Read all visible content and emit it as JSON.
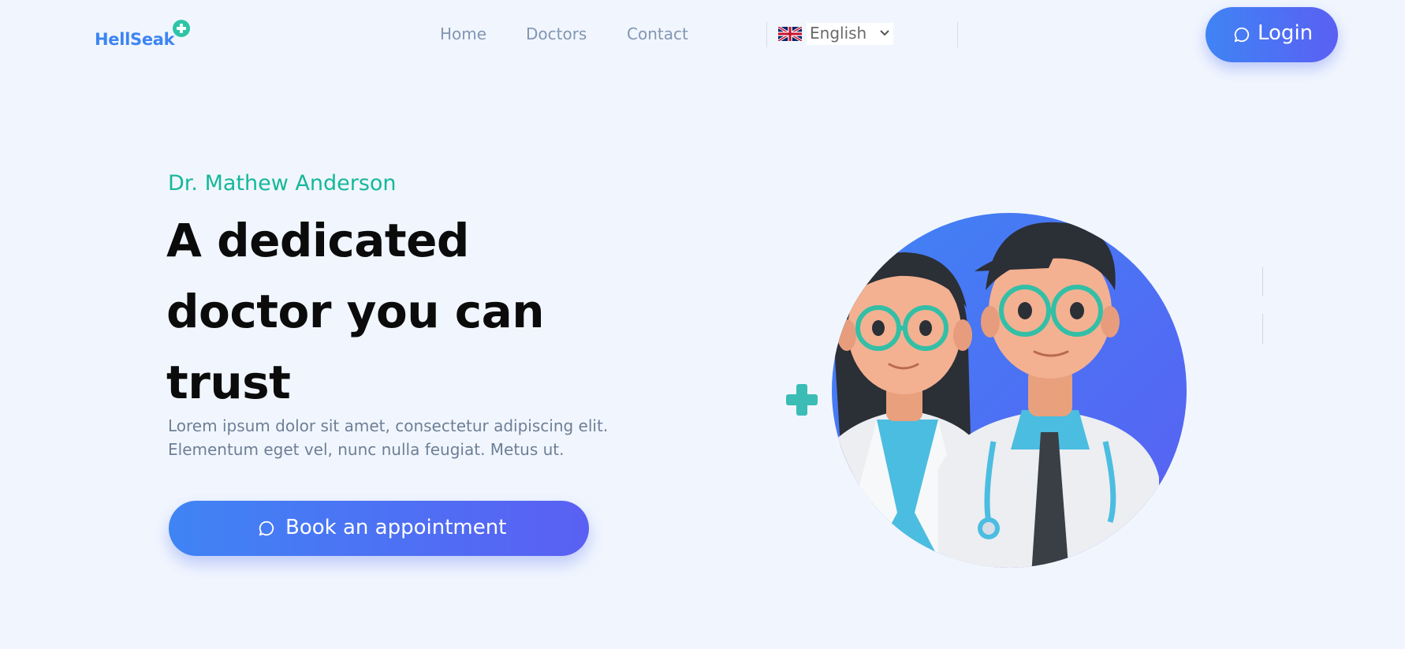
{
  "brand": {
    "name": "HellSeak",
    "icon": "plus-icon",
    "color": "#3e85f3",
    "accent": "#2ec4a8"
  },
  "nav": {
    "links": [
      "Home",
      "Doctors",
      "Contact"
    ]
  },
  "language": {
    "selected": "English",
    "flag": "uk-flag-icon"
  },
  "login": {
    "label": "Login",
    "icon": "chat-icon"
  },
  "hero": {
    "name": "Dr. Mathew Anderson",
    "title": "A dedicated doctor you can trust",
    "description": "Lorem ipsum dolor sit amet, consectetur adipiscing elit. Elementum eget vel, nunc nulla feugiat. Metus ut.",
    "cta": {
      "label": "Book an appointment",
      "icon": "chat-icon"
    },
    "illustration": "doctors-illustration"
  },
  "colors": {
    "background": "#f1f6fe",
    "primary_gradient": [
      "#3f84f4",
      "#5a60f3"
    ],
    "name_color": "#14b89a"
  }
}
